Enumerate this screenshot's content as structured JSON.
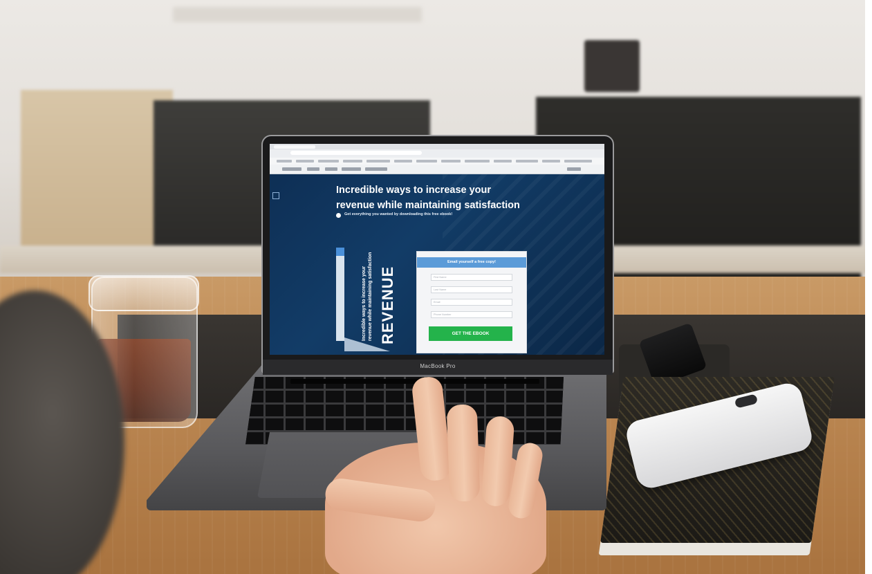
{
  "screen": {
    "headline_line1": "Incredible ways to increase your",
    "headline_line2": "revenue while maintaining satisfaction",
    "subline": "Get everything you wanted by downloading this free ebook!",
    "book": {
      "side_text_line1": "Incredible ways to increase your",
      "side_text_line2": "revenue while maintaining satisfaction",
      "title": "REVENUE"
    },
    "form": {
      "header": "Email yourself a free copy!",
      "fields": [
        "First Name",
        "Last Name",
        "Email",
        "Phone Number"
      ],
      "button_label": "GET THE EBOOK"
    }
  },
  "laptop": {
    "model_label": "MacBook Pro"
  },
  "colors": {
    "hero_background": "#0e2f55",
    "form_header": "#5b9bd8",
    "cta_button": "#24b34b",
    "table_wood": "#bb8752"
  }
}
